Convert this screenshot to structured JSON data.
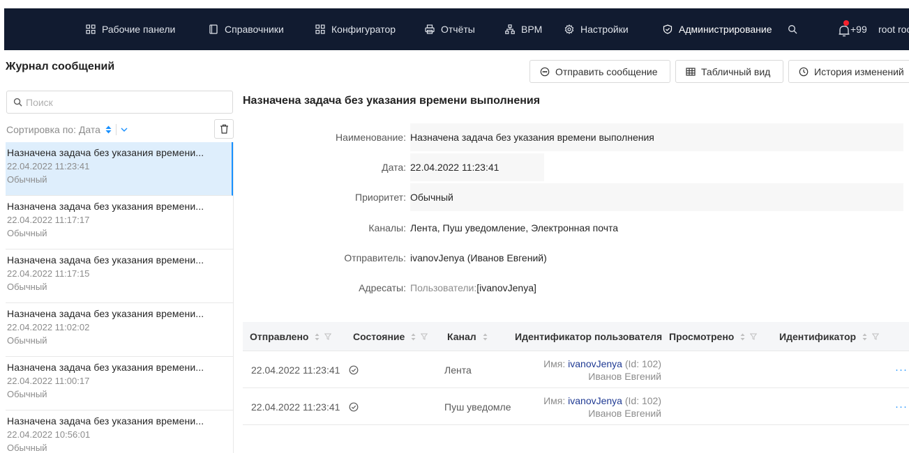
{
  "nav": {
    "items": [
      {
        "label": "Рабочие панели",
        "icon": "grid-icon"
      },
      {
        "label": "Справочники",
        "icon": "document-icon"
      },
      {
        "label": "Конфигуратор",
        "icon": "grid-icon"
      },
      {
        "label": "Отчёты",
        "icon": "printer-icon"
      },
      {
        "label": "BPM",
        "icon": "sitemap-icon"
      },
      {
        "label": "Настройки",
        "icon": "gear-icon"
      },
      {
        "label": "Администрирование",
        "icon": "shield-icon"
      }
    ],
    "notifications_count": "+99",
    "user": "root root"
  },
  "page": {
    "title": "Журнал сообщений",
    "buttons": {
      "send": "Отправить сообщение",
      "table_view": "Табличный вид",
      "history": "История изменений"
    }
  },
  "sidebar": {
    "search_placeholder": "Поиск",
    "sort_label": "Сортировка по: Дата",
    "items": [
      {
        "title": "Назначена задача без указания времени...",
        "date": "22.04.2022 11:23:41",
        "priority": "Обычный"
      },
      {
        "title": "Назначена задача без указания времени...",
        "date": "22.04.2022 11:17:17",
        "priority": "Обычный"
      },
      {
        "title": "Назначена задача без указания времени...",
        "date": "22.04.2022 11:17:15",
        "priority": "Обычный"
      },
      {
        "title": "Назначена задача без указания времени...",
        "date": "22.04.2022 11:02:02",
        "priority": "Обычный"
      },
      {
        "title": "Назначена задача без указания времени...",
        "date": "22.04.2022 11:00:17",
        "priority": "Обычный"
      },
      {
        "title": "Назначена задача без указания времени...",
        "date": "22.04.2022 10:56:01",
        "priority": "Обычный"
      }
    ]
  },
  "detail": {
    "title": "Назначена задача без указания времени выполнения",
    "fields": {
      "name_label": "Наименование:",
      "name_value": "Назначена задача без указания времени выполнения",
      "date_label": "Дата:",
      "date_value": "22.04.2022 11:23:41",
      "priority_label": "Приоритет:",
      "priority_value": "Обычный",
      "channels_label": "Каналы:",
      "channels_value": "Лента, Пуш уведомление, Электронная почта",
      "sender_label": "Отправитель:",
      "sender_value": "ivanovJenya (Иванов Евгений)",
      "recipients_label": "Адресаты:",
      "recipients_prefix": "Пользователи: ",
      "recipients_value": "[ivanovJenya]"
    }
  },
  "table": {
    "columns": [
      "Отправлено",
      "Состояние",
      "Канал",
      "Идентификатор пользователя",
      "Просмотрено",
      "Идентификатор"
    ],
    "rows": [
      {
        "sent": "22.04.2022 11:23:41",
        "channel": "Лента",
        "user_line1_prefix": "Имя: ",
        "user_login": "ivanovJenya",
        "user_id": " (Id: 102)",
        "user_name": "Иванов Евгений"
      },
      {
        "sent": "22.04.2022 11:23:41",
        "channel": "Пуш уведомле",
        "user_line1_prefix": "Имя: ",
        "user_login": "ivanovJenya",
        "user_id": " (Id: 102)",
        "user_name": "Иванов Евгений"
      }
    ]
  },
  "colors": {
    "topbar": "#111b30",
    "accent": "#1890ff",
    "selected_row": "#deeefc",
    "notification": "#f5222d"
  }
}
